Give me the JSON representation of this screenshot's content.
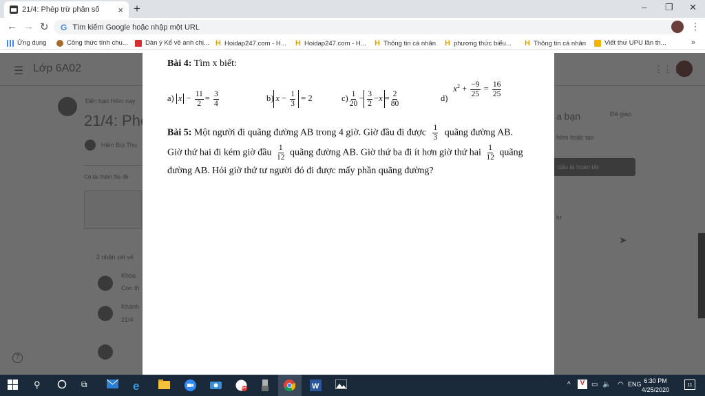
{
  "browser": {
    "tab_title": "21/4: Phép trừ phân số",
    "close_glyph": "×",
    "new_tab_glyph": "+",
    "minimize_glyph": "–",
    "restore_glyph": "❐",
    "window_close_glyph": "✕",
    "omnibox_placeholder": "Tìm kiếm Google hoặc nhập một URL",
    "bookmarks_apps": "Ứng dụng",
    "bookmarks": [
      "Công thức tính chu...",
      "Dàn ý Kể về anh chị...",
      "Hoidap247.com - H...",
      "Hoidap247.com - H...",
      "Thông tin cá nhân",
      "phương thức biểu...",
      "Thông tin cá nhân",
      "Viết thư UPU lần th..."
    ],
    "bookmarks_more": "»"
  },
  "classroom": {
    "class_name": "Lớp 6A02",
    "due": "Đến hạn Hôm nay",
    "assignment_title": "21/4: Phé",
    "teacher": "Hiền Bùi Thu",
    "attach_hint": "Cô tải thêm file đề",
    "your_work": "a bạn",
    "assigned": "Đã giao",
    "add_create": "hêm hoặc tạo",
    "mark_done": "dấu là hoàn tất",
    "private_comment": "tư",
    "comments_count": "2 nhận xét về",
    "comment1_name": "Khoa",
    "comment1_text": "Con th",
    "comment2_name": "Khánh",
    "comment2_text": "21/4"
  },
  "document": {
    "bai4_label": "Bài 4:",
    "bai4_text": " Tìm x biết:",
    "a_label": "a)",
    "b_label": "b)",
    "c_label": "c)",
    "d_label": "d)",
    "bai5_label": "Bài 5:",
    "bai5_line1_a": " Một người đi quãng đường AB trong 4 giờ. Giờ đầu đi được",
    "bai5_line1_b": "quãng đường AB.",
    "bai5_line2_a": "Giờ thứ hai đi kém giờ đầu",
    "bai5_line2_b": "quãng đường AB. Giờ thứ ba đi ít hơn giờ thứ hai",
    "bai5_line2_c": "quãng",
    "bai5_line3": "đường AB. Hỏi giờ thứ tư người đó đi được mấy phần quãng đường?"
  },
  "taskbar": {
    "lang": "ENG",
    "time": "6:30 PM",
    "date": "4/25/2020",
    "notif_count": "11",
    "zalo_badge": "5+"
  }
}
